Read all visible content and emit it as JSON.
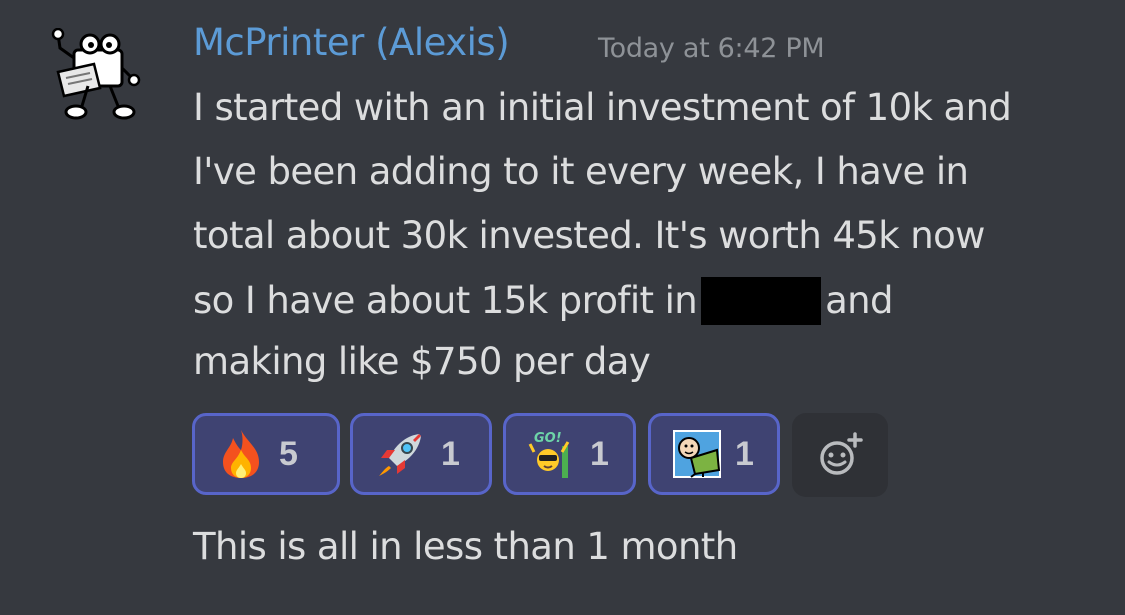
{
  "message": {
    "username": "McPrinter (Alexis)",
    "timestamp": "Today at 6:42 PM",
    "lines": [
      "I started with an initial investment of 10k and",
      "I've been adding to it every week, I have in",
      "total about 30k invested. It's worth 45k now",
      "so I have about 15k profit in",
      "and",
      "making like $750 per day"
    ],
    "followup": "This is all in less than 1 month"
  },
  "reactions": [
    {
      "icon": "fire-emoji-icon",
      "count": "5"
    },
    {
      "icon": "rocket-emoji-icon",
      "count": "1"
    },
    {
      "icon": "go-emote-icon",
      "count": "1"
    },
    {
      "icon": "cyanide-character-emote-icon",
      "count": "1"
    }
  ],
  "avatar_icon": "printer-mascot-avatar",
  "add_reaction_icon": "add-reaction-smiley-icon",
  "colors": {
    "background": "#36393f",
    "username": "#5c9bd6",
    "text": "#dcddde",
    "timestamp": "#8e9297",
    "reaction_border": "#5865c9",
    "reaction_fill": "#3f4372"
  }
}
